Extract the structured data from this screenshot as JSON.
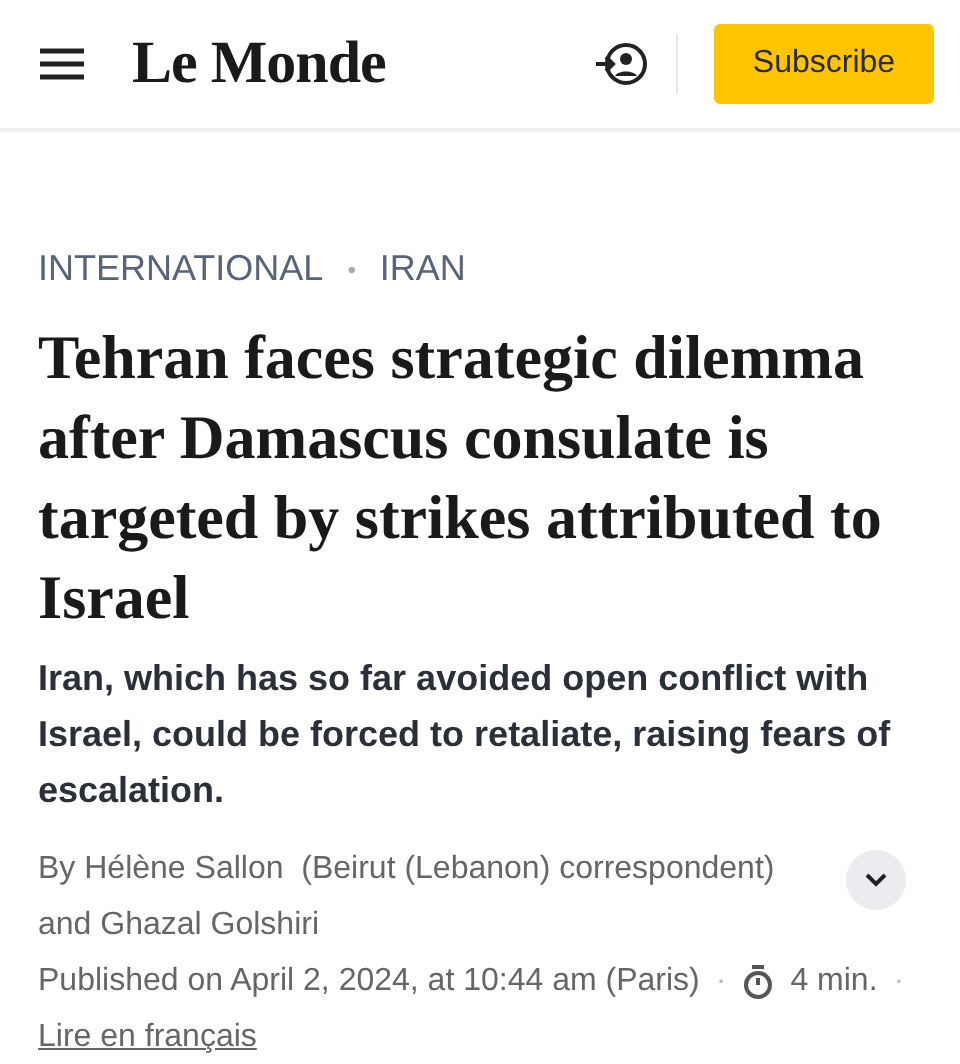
{
  "header": {
    "logo": "Le Monde",
    "subscribe": "Subscribe"
  },
  "kicker": {
    "section": "INTERNATIONAL",
    "separator": "•",
    "topic": "IRAN"
  },
  "headline": "Tehran faces strategic dilemma after Damascus consulate is targeted by strikes attributed to Israel",
  "standfirst": "Iran, which has so far avoided open conflict with Israel, could be forced to retaliate, raising fears of escalation.",
  "byline": "By Hélène Sallon  (Beirut (Lebanon) correspondent) and Ghazal Golshiri",
  "meta": {
    "published": "Published on April 2, 2024, at 10:44 am (Paris)",
    "separator_1": "·",
    "reading_time": "4 min.",
    "separator_2": "·",
    "language_link": "Lire en français"
  }
}
